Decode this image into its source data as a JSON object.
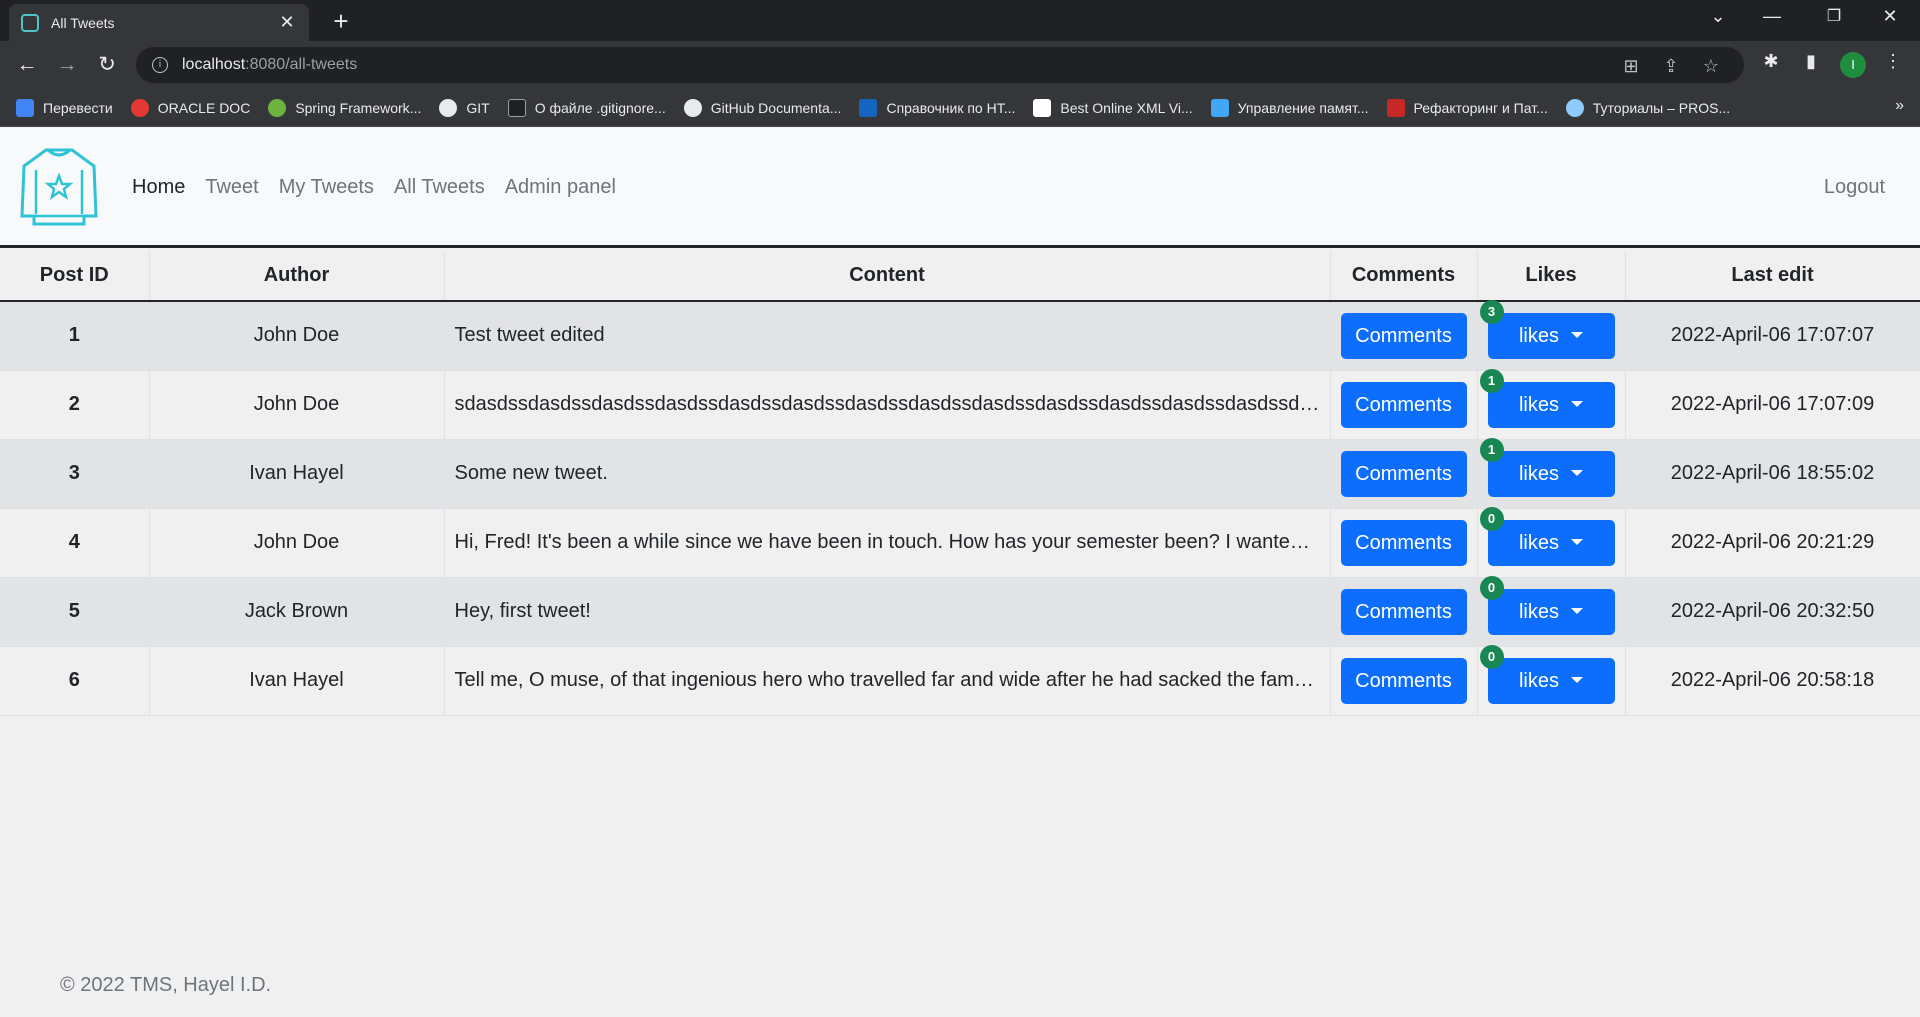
{
  "browser": {
    "tab_title": "All Tweets",
    "url_host": "localhost",
    "url_rest": ":8080/all-tweets",
    "profile_initial": "I",
    "bookmarks": [
      {
        "label": "Перевести",
        "color": "#4285f4"
      },
      {
        "label": "ORACLE DOC",
        "color": "#e53935"
      },
      {
        "label": "Spring Framework...",
        "color": "#6db33f"
      },
      {
        "label": "GIT",
        "color": "#e8eaed"
      },
      {
        "label": "О файле .gitignore...",
        "color": "#202124"
      },
      {
        "label": "GitHub Documenta...",
        "color": "#e8eaed"
      },
      {
        "label": "Справочник по HT...",
        "color": "#1565c0"
      },
      {
        "label": "Best Online XML Vi...",
        "color": "#ffffff"
      },
      {
        "label": "Управление памят...",
        "color": "#42a5f5"
      },
      {
        "label": "Рефакторинг и Пат...",
        "color": "#c62828"
      },
      {
        "label": "Туториалы – PROS...",
        "color": "#90caf9"
      }
    ]
  },
  "nav": {
    "links": [
      "Home",
      "Tweet",
      "My Tweets",
      "All Tweets",
      "Admin panel"
    ],
    "active": "Home",
    "logout": "Logout"
  },
  "table": {
    "headers": [
      "Post ID",
      "Author",
      "Content",
      "Comments",
      "Likes",
      "Last edit"
    ],
    "comments_label": "Comments",
    "likes_label": "likes",
    "rows": [
      {
        "id": "1",
        "author": "John Doe",
        "content": "Test tweet edited",
        "likes": "3",
        "last_edit": "2022-April-06 17:07:07"
      },
      {
        "id": "2",
        "author": "John Doe",
        "content": "sdasdssdasdssdasdssdasdssdasdssdasdssdasdssdasdssdasdssdasdssdasdssdasdssdasdssdasdssdasdssd…",
        "likes": "1",
        "last_edit": "2022-April-06 17:07:09"
      },
      {
        "id": "3",
        "author": "Ivan Hayel",
        "content": "Some new tweet.",
        "likes": "1",
        "last_edit": "2022-April-06 18:55:02"
      },
      {
        "id": "4",
        "author": "John Doe",
        "content": "Hi, Fred! It's been a while since we have been in touch. How has your semester been? I wanted …",
        "likes": "0",
        "last_edit": "2022-April-06 20:21:29"
      },
      {
        "id": "5",
        "author": "Jack Brown",
        "content": "Hey, first tweet!",
        "likes": "0",
        "last_edit": "2022-April-06 20:32:50"
      },
      {
        "id": "6",
        "author": "Ivan Hayel",
        "content": "Tell me, O muse, of that ingenious hero who travelled far and wide after he had sacked the famo…",
        "likes": "0",
        "last_edit": "2022-April-06 20:58:18"
      }
    ]
  },
  "footer": "© 2022 TMS, Hayel I.D."
}
